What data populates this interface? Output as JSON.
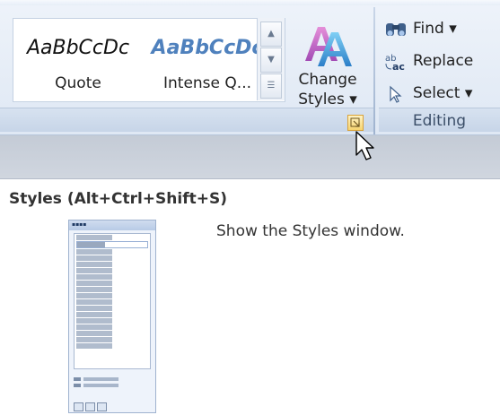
{
  "ribbon": {
    "styles_gallery": [
      {
        "sample": "AaBbCcDc",
        "label": "Quote"
      },
      {
        "sample": "AaBbCcDc",
        "label": "Intense Q..."
      }
    ],
    "change_styles": {
      "line1": "Change",
      "line2": "Styles ▾"
    },
    "editing": {
      "find": "Find ▾",
      "replace": "Replace",
      "select": "Select ▾",
      "group_label": "Editing"
    }
  },
  "tooltip": {
    "title": "Styles (Alt+Ctrl+Shift+S)",
    "description": "Show the Styles window."
  },
  "colors": {
    "ribbon_bg": "#dfe8f4",
    "intense_quote": "#4f81bd",
    "launcher": "#f6d470"
  }
}
